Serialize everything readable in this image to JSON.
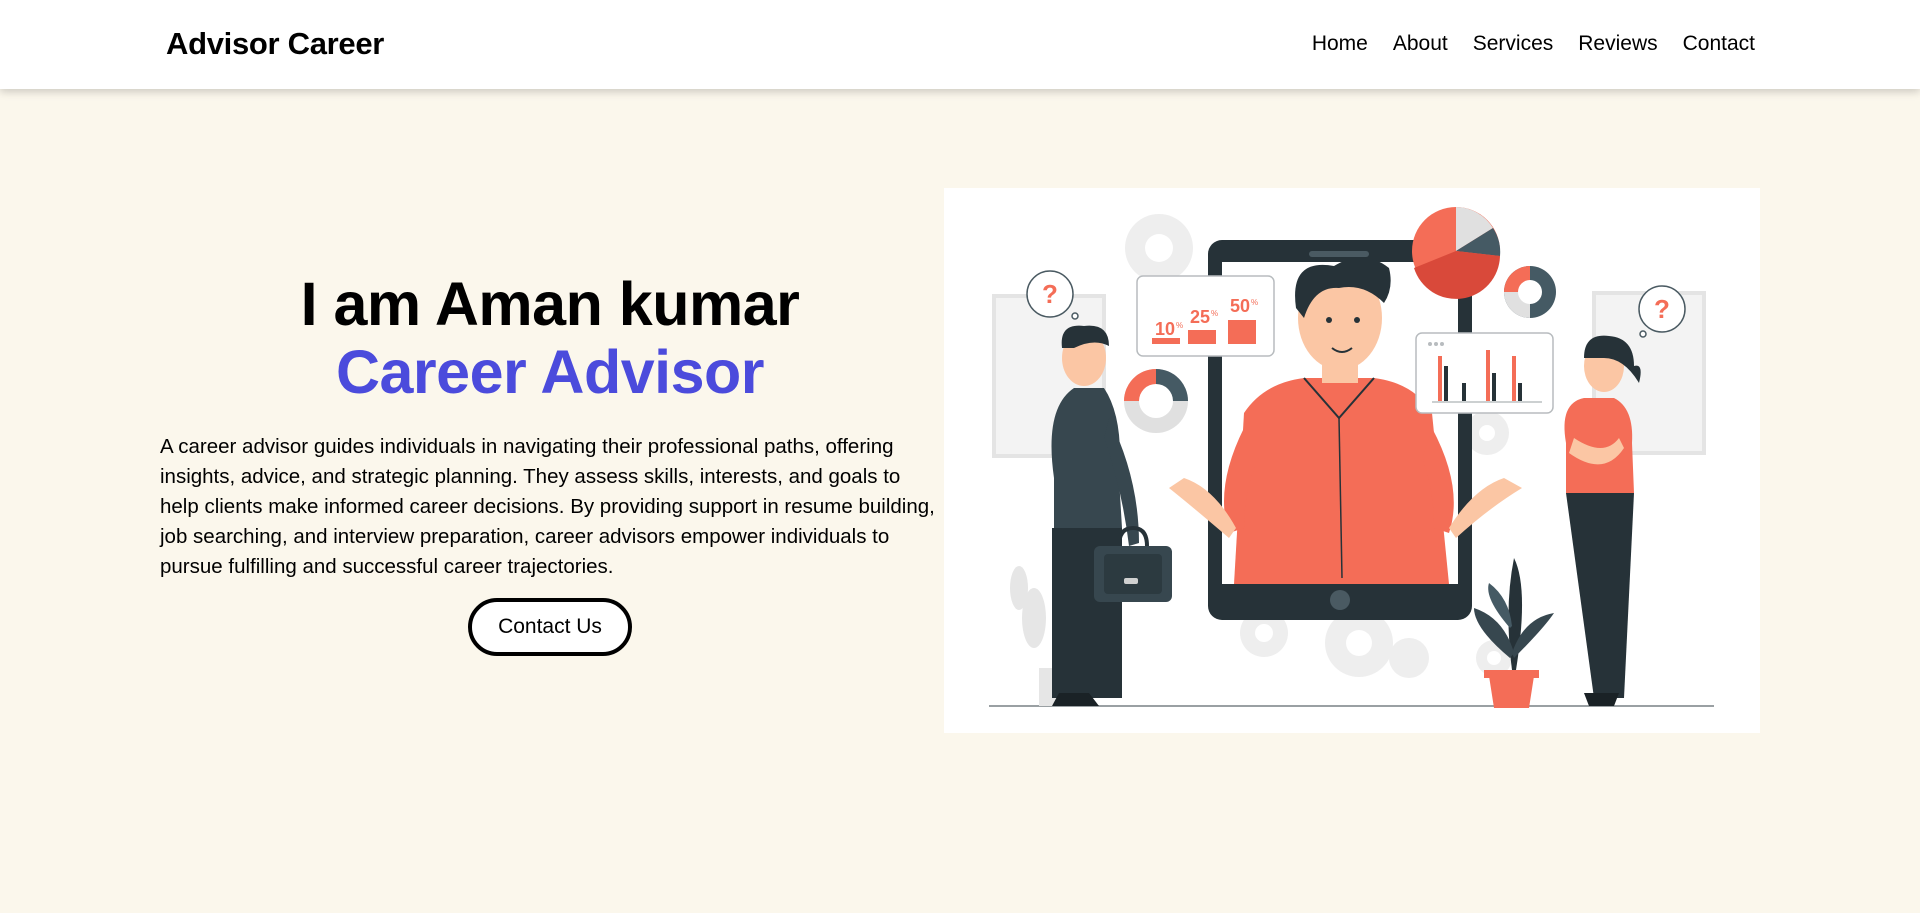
{
  "nav": {
    "brand": "Advisor Career",
    "links": [
      "Home",
      "About",
      "Services",
      "Reviews",
      "Contact"
    ]
  },
  "hero": {
    "name_line": "I am Aman kumar",
    "role_line": "Career Advisor",
    "description": "A career advisor guides individuals in navigating their professional paths, offering insights, advice, and strategic planning. They assess skills, interests, and goals to help clients make informed career decisions. By providing support in resume building, job searching, and interview preparation, career advisors empower individuals to pursue fulfilling and successful career trajectories.",
    "cta_label": "Contact Us"
  },
  "illustration": {
    "question_mark": "?",
    "stat_labels": [
      "10",
      "25",
      "50"
    ],
    "stat_unit": "%"
  },
  "colors": {
    "accent": "#4b4bdc",
    "coral": "#f46d57",
    "dark_slate": "#263238",
    "background": "#fbf7ec"
  }
}
